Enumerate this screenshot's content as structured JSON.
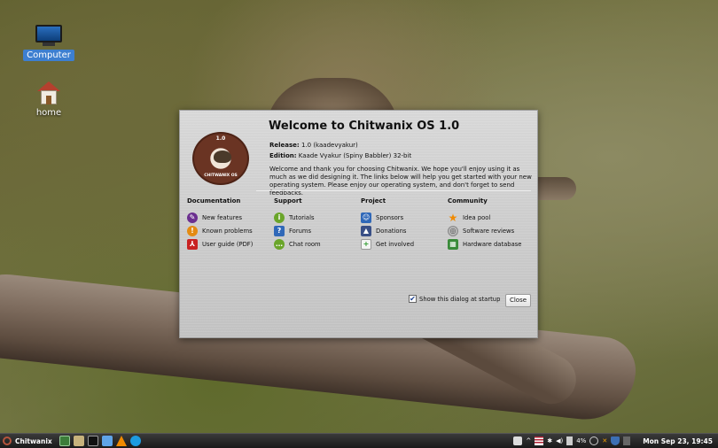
{
  "desktop": {
    "icons": [
      {
        "label": "Computer",
        "selected": true
      },
      {
        "label": "home",
        "selected": false
      }
    ]
  },
  "dialog": {
    "title": "Welcome to Chitwanix OS 1.0",
    "logo": {
      "version_text": "1.0",
      "name_text": "CHITWANIX OS"
    },
    "release_label": "Release:",
    "release_value": "1.0 (kaadevyakur)",
    "edition_label": "Edition:",
    "edition_value": "Kaade Vyakur (Spiny Babbler) 32-bit",
    "intro": "Welcome and thank you for choosing Chitwanix. We hope you'll enjoy using it as much as we did designing it. The links below will help you get started with your new operating system. Please enjoy our operating system, and don't forget to send feedbacks.",
    "columns": [
      {
        "heading": "Documentation",
        "links": [
          {
            "label": "New features",
            "icon": "new-features-icon"
          },
          {
            "label": "Known problems",
            "icon": "warning-icon"
          },
          {
            "label": "User guide (PDF)",
            "icon": "pdf-icon"
          }
        ]
      },
      {
        "heading": "Support",
        "links": [
          {
            "label": "Tutorials",
            "icon": "info-icon"
          },
          {
            "label": "Forums",
            "icon": "help-icon"
          },
          {
            "label": "Chat room",
            "icon": "chat-icon"
          }
        ]
      },
      {
        "heading": "Project",
        "links": [
          {
            "label": "Sponsors",
            "icon": "sponsor-icon"
          },
          {
            "label": "Donations",
            "icon": "donation-icon"
          },
          {
            "label": "Get involved",
            "icon": "plus-icon"
          }
        ]
      },
      {
        "heading": "Community",
        "links": [
          {
            "label": "Idea pool",
            "icon": "star-icon"
          },
          {
            "label": "Software reviews",
            "icon": "reviews-icon"
          },
          {
            "label": "Hardware database",
            "icon": "hardware-icon"
          }
        ]
      }
    ],
    "show_at_startup_label": "Show this dialog at startup",
    "show_at_startup_checked": true,
    "close_label": "Close"
  },
  "taskbar": {
    "menu_label": "Chitwanix",
    "launchers": [
      "terminal-icon",
      "settings-icon",
      "console-icon",
      "files-icon",
      "vlc-icon",
      "skype-icon"
    ],
    "tray": {
      "battery_text": "4%",
      "clock": "Mon Sep 23, 19:45"
    }
  },
  "colors": {
    "accent": "#3d7fd0",
    "taskbar_bg": "#1a1a1a",
    "dialog_bg": "#cfcfcf"
  }
}
